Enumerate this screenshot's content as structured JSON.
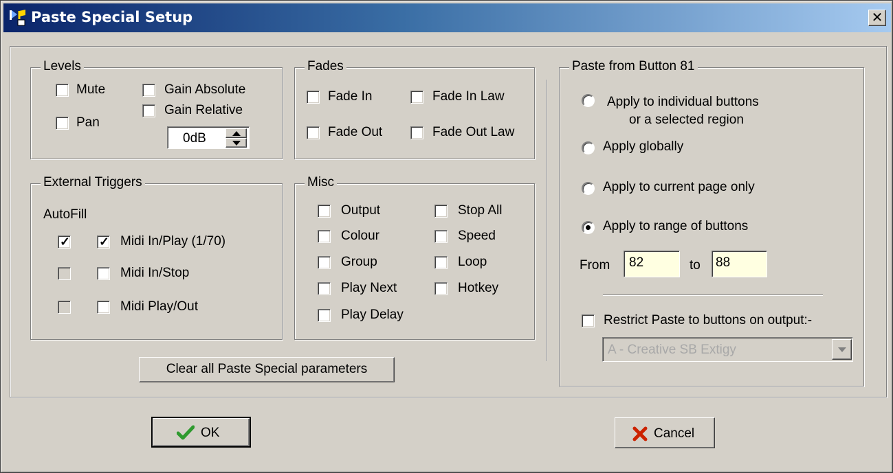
{
  "window": {
    "title": "Paste Special Setup",
    "close_label": "✕"
  },
  "levels": {
    "legend": "Levels",
    "mute": {
      "label": "Mute",
      "checked": false
    },
    "pan": {
      "label": "Pan",
      "checked": false
    },
    "gain_absolute": {
      "label": "Gain Absolute",
      "checked": false
    },
    "gain_relative": {
      "label": "Gain Relative",
      "checked": false
    },
    "gain_value": "0dB"
  },
  "fades": {
    "legend": "Fades",
    "fade_in": "Fade In",
    "fade_in_law": "Fade In Law",
    "fade_out": "Fade Out",
    "fade_out_law": "Fade Out Law"
  },
  "external_triggers": {
    "legend": "External Triggers",
    "autofill_label": "AutoFill",
    "items": [
      {
        "label": "Midi In/Play (1/70)",
        "autofill_checked": true,
        "checked": true
      },
      {
        "label": "Midi In/Stop",
        "autofill_checked": false,
        "checked": false
      },
      {
        "label": "Midi Play/Out",
        "autofill_checked": false,
        "checked": false
      }
    ]
  },
  "misc": {
    "legend": "Misc",
    "output": "Output",
    "colour": "Colour",
    "group": "Group",
    "play_next": "Play Next",
    "play_delay": "Play Delay",
    "stop_all": "Stop All",
    "speed": "Speed",
    "loop": "Loop",
    "hotkey": "Hotkey"
  },
  "clear_button": "Clear all Paste Special parameters",
  "paste_from": {
    "legend": "Paste from Button 81",
    "option_individual_line1": "Apply to individual buttons",
    "option_individual_line2": "or a selected region",
    "option_global": "Apply globally",
    "option_current_page": "Apply to current page only",
    "option_range": "Apply to range of buttons",
    "selected_option": "range",
    "from_label": "From",
    "from_value": "82",
    "to_label": "to",
    "to_value": "88",
    "restrict_label": "Restrict Paste to buttons on output:-",
    "restrict_checked": false,
    "output_select": "A - Creative SB Extigy"
  },
  "buttons": {
    "ok": "OK",
    "cancel": "Cancel"
  },
  "colors": {
    "title_start": "#0a246a",
    "title_end": "#a6caf0",
    "input_bg": "#ffffe1",
    "ok_check": "#2f9a2f",
    "cancel_x": "#cc2200"
  }
}
